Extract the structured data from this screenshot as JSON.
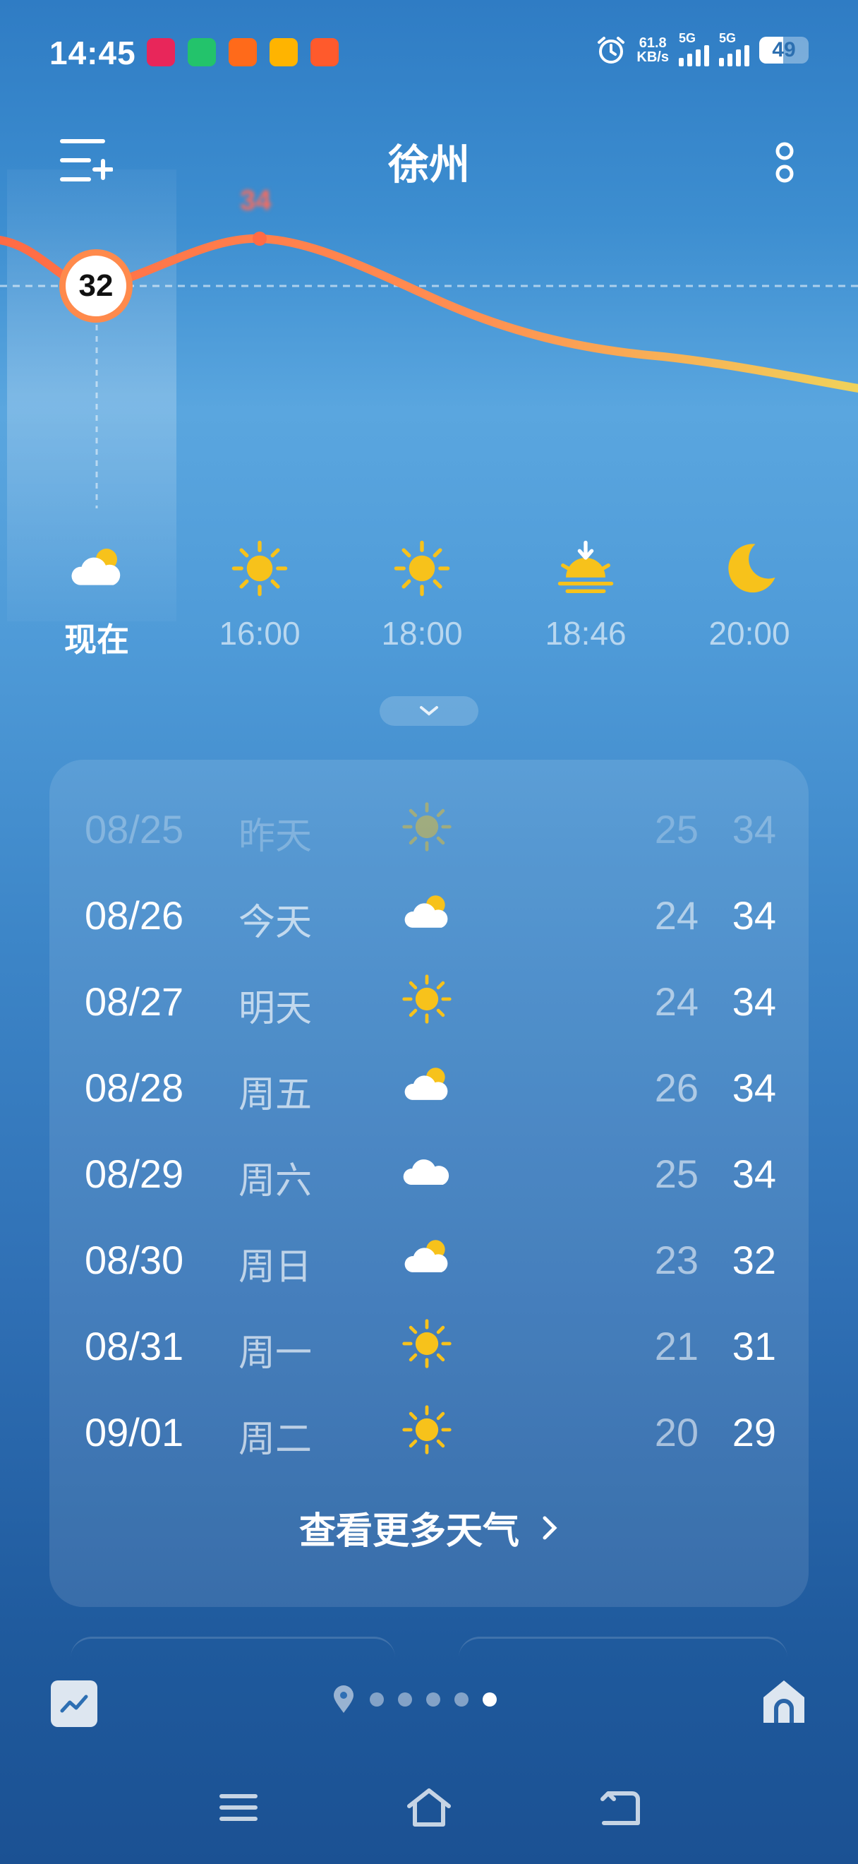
{
  "status_bar": {
    "time": "14:45",
    "app_icons": [
      {
        "name": "kuaishou-mall-icon",
        "color": "#e8265a"
      },
      {
        "name": "video-app-icon",
        "color": "#23c36b"
      },
      {
        "name": "kuaishou-icon",
        "color": "#ff6a1a"
      },
      {
        "name": "tf-app-icon",
        "color": "#ffb400"
      },
      {
        "name": "taobao-flash-icon",
        "color": "#ff5a2c"
      }
    ],
    "net_speed_value": "61.8",
    "net_speed_unit": "KB/s",
    "signal1_label": "5G",
    "signal2_label": "5G",
    "battery": "49"
  },
  "header": {
    "city": "徐州",
    "menu_icon": "menu-add-icon",
    "more_icon": "more-icon"
  },
  "chart": {
    "current_temp": "32",
    "peak_temp": "34",
    "curve_start_color": "#ff6b45",
    "curve_end_color": "#f0d25a"
  },
  "hourly": [
    {
      "time": "现在",
      "icon": "partly-cloudy-icon",
      "current": true
    },
    {
      "time": "16:00",
      "icon": "sun-icon"
    },
    {
      "time": "18:00",
      "icon": "sun-icon"
    },
    {
      "time": "18:46",
      "icon": "sunset-icon"
    },
    {
      "time": "20:00",
      "icon": "moon-icon"
    }
  ],
  "forecast": [
    {
      "date": "08/25",
      "day": "昨天",
      "icon": "sun-icon",
      "low": "25",
      "high": "34",
      "past": true
    },
    {
      "date": "08/26",
      "day": "今天",
      "icon": "partly-cloudy-icon",
      "low": "24",
      "high": "34"
    },
    {
      "date": "08/27",
      "day": "明天",
      "icon": "sun-icon",
      "low": "24",
      "high": "34"
    },
    {
      "date": "08/28",
      "day": "周五",
      "icon": "partly-cloudy-icon",
      "low": "26",
      "high": "34"
    },
    {
      "date": "08/29",
      "day": "周六",
      "icon": "cloud-icon",
      "low": "25",
      "high": "34"
    },
    {
      "date": "08/30",
      "day": "周日",
      "icon": "partly-cloudy-icon",
      "low": "23",
      "high": "32"
    },
    {
      "date": "08/31",
      "day": "周一",
      "icon": "sun-icon",
      "low": "21",
      "high": "31"
    },
    {
      "date": "09/01",
      "day": "周二",
      "icon": "sun-icon",
      "low": "20",
      "high": "29"
    }
  ],
  "more_weather_label": "查看更多天气",
  "pager": {
    "count": 5,
    "active": 4
  },
  "colors": {
    "sun": "#f7c21b",
    "cloud": "#ffffff",
    "accent": "#ff8a4c"
  }
}
